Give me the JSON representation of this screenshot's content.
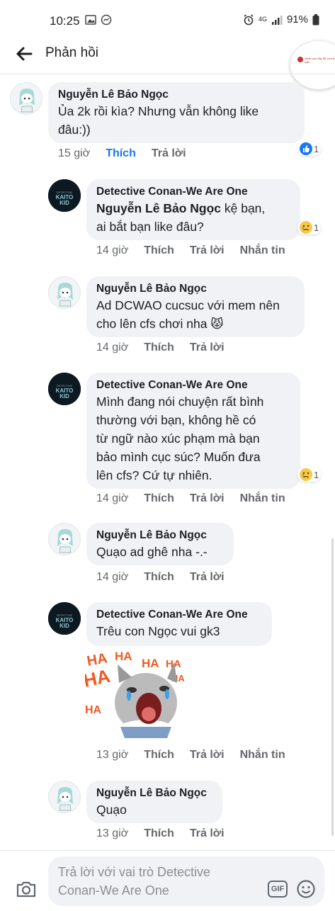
{
  "status_bar": {
    "time": "10:25",
    "network": "4G",
    "battery": "91%"
  },
  "header": {
    "title": "Phản hồi",
    "thumb_text": "Nhấn vào đây để xem bình luận"
  },
  "comments": [
    {
      "author": "Nguyễn Lê Bảo Ngọc",
      "lines": [
        "Ủa 2k rồi kìa? Nhưng vẫn không like",
        "đâu:))"
      ],
      "time": "15 giờ",
      "like": "Thích",
      "reply": "Trả lời",
      "reaction_count": "1",
      "reaction_type": "like"
    },
    {
      "author": "Detective Conan-We Are One",
      "mention": "Nguyễn Lê Bảo Ngọc",
      "lines": [
        " kệ bạn,",
        "ai bắt bạn like đâu?"
      ],
      "time": "14 giờ",
      "like": "Thích",
      "reply": "Trả lời",
      "message": "Nhắn tin",
      "reaction_count": "1",
      "reaction_type": "sad"
    },
    {
      "author": "Nguyễn Lê Bảo Ngọc",
      "lines": [
        "Ad DCWAO cucsuc với mem nên",
        "cho lên cfs chơi nha 😾"
      ],
      "time": "14 giờ",
      "like": "Thích",
      "reply": "Trả lời"
    },
    {
      "author": "Detective Conan-We Are One",
      "lines": [
        "Mình đang nói chuyện rất bình",
        "thường với bạn, không hề có",
        "từ ngữ nào xúc phạm mà bạn",
        "bảo mình cục súc? Muốn đưa",
        "lên cfs? Cứ tự nhiên."
      ],
      "time": "14 giờ",
      "like": "Thích",
      "reply": "Trả lời",
      "message": "Nhắn tin",
      "reaction_count": "1",
      "reaction_type": "sad"
    },
    {
      "author": "Nguyễn Lê Bảo Ngọc",
      "lines": [
        "Quạo ad ghê nha -.-"
      ],
      "time": "14 giờ",
      "like": "Thích",
      "reply": "Trả lời"
    },
    {
      "author": "Detective Conan-We Are One",
      "lines": [
        "Trêu con Ngọc vui gk3"
      ],
      "time": "13 giờ",
      "like": "Thích",
      "reply": "Trả lời",
      "message": "Nhắn tin",
      "sticker": "HA HA HA HA"
    },
    {
      "author": "Nguyễn Lê Bảo Ngọc",
      "lines": [
        "Quạo"
      ],
      "time": "13 giờ",
      "like": "Thích",
      "reply": "Trả lời"
    }
  ],
  "composer": {
    "placeholder_line1": "Trả lời với vai trò Detective",
    "placeholder_line2": "Conan-We Are One",
    "gif": "GIF"
  },
  "colors": {
    "link_blue": "#1877f2",
    "bubble": "#f0f2f5",
    "meta_gray": "#65676b"
  }
}
